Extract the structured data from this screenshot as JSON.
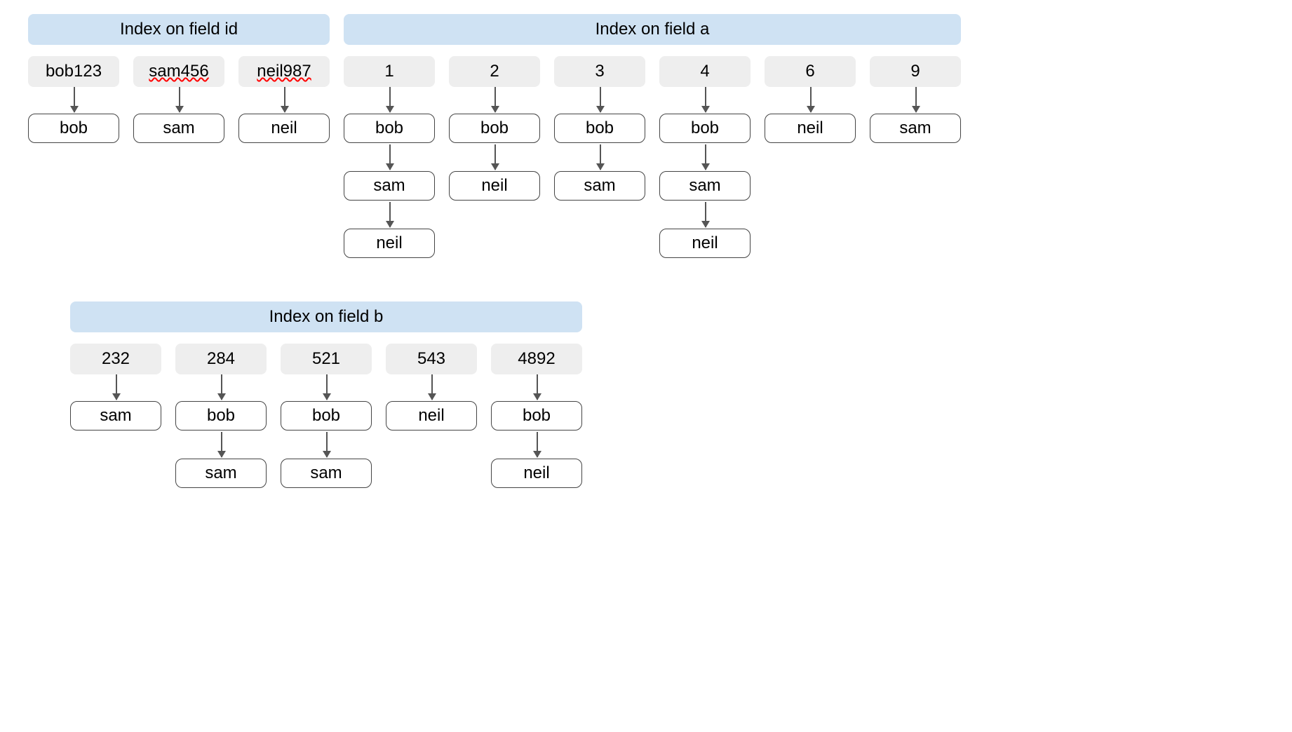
{
  "indexes": {
    "id": {
      "title": "Index on field id",
      "columns": [
        {
          "key": "bob123",
          "squiggle": false,
          "values": [
            "bob"
          ]
        },
        {
          "key": "sam456",
          "squiggle": true,
          "values": [
            "sam"
          ]
        },
        {
          "key": "neil987",
          "squiggle": true,
          "values": [
            "neil"
          ]
        }
      ]
    },
    "a": {
      "title": "Index on field a",
      "columns": [
        {
          "key": "1",
          "values": [
            "bob",
            "sam",
            "neil"
          ]
        },
        {
          "key": "2",
          "values": [
            "bob",
            "neil"
          ]
        },
        {
          "key": "3",
          "values": [
            "bob",
            "sam"
          ]
        },
        {
          "key": "4",
          "values": [
            "bob",
            "sam",
            "neil"
          ]
        },
        {
          "key": "6",
          "values": [
            "neil"
          ]
        },
        {
          "key": "9",
          "values": [
            "sam"
          ]
        }
      ]
    },
    "b": {
      "title": "Index on field b",
      "columns": [
        {
          "key": "232",
          "values": [
            "sam"
          ]
        },
        {
          "key": "284",
          "values": [
            "bob",
            "sam"
          ]
        },
        {
          "key": "521",
          "values": [
            "bob",
            "sam"
          ]
        },
        {
          "key": "543",
          "values": [
            "neil"
          ]
        },
        {
          "key": "4892",
          "values": [
            "bob",
            "neil"
          ]
        }
      ]
    }
  }
}
